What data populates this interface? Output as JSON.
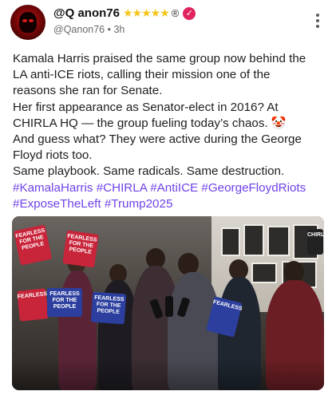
{
  "post": {
    "author": {
      "display_name": "@Q anon76",
      "stars": "★★★★★",
      "registered_mark": "®",
      "verified_icon": "check-badge-icon",
      "handle": "@Qanon76",
      "separator": "•",
      "time": "3h"
    },
    "more_icon": "more-vertical-icon",
    "body": {
      "line1": "Kamala Harris praised the same group now behind the",
      "line2": "LA anti-ICE riots, calling their mission one of the",
      "line3": "reasons she ran for Senate.",
      "line4": "Her first appearance as Senator-elect in 2016? At",
      "line5_text": "CHIRLA HQ — the group fueling today’s chaos. ",
      "line5_emoji": "🤡",
      "line6": "And guess what? They were active during the George",
      "line7": "Floyd riots too.",
      "line8": "Same playbook. Same radicals. Same destruction."
    },
    "hashtags": {
      "line1": [
        "#KamalaHarris",
        "#CHIRLA",
        "#AntiICE",
        "#GeorgeFloydRiots"
      ],
      "line2": [
        "#ExposeTheLeft",
        "#Trump2025"
      ]
    },
    "media": {
      "description_signs": [
        "FEARLESS FOR THE PEOPLE",
        "FEARLESS FOR THE PEOPLE",
        "FEARLESS FOR THE PEOPLE",
        "FEARLESS",
        "FEARLESS",
        "CHIRLA"
      ]
    },
    "colors": {
      "hashtag": "#6f42e8",
      "verified": "#e0245e",
      "stars": "#f5c518"
    }
  }
}
